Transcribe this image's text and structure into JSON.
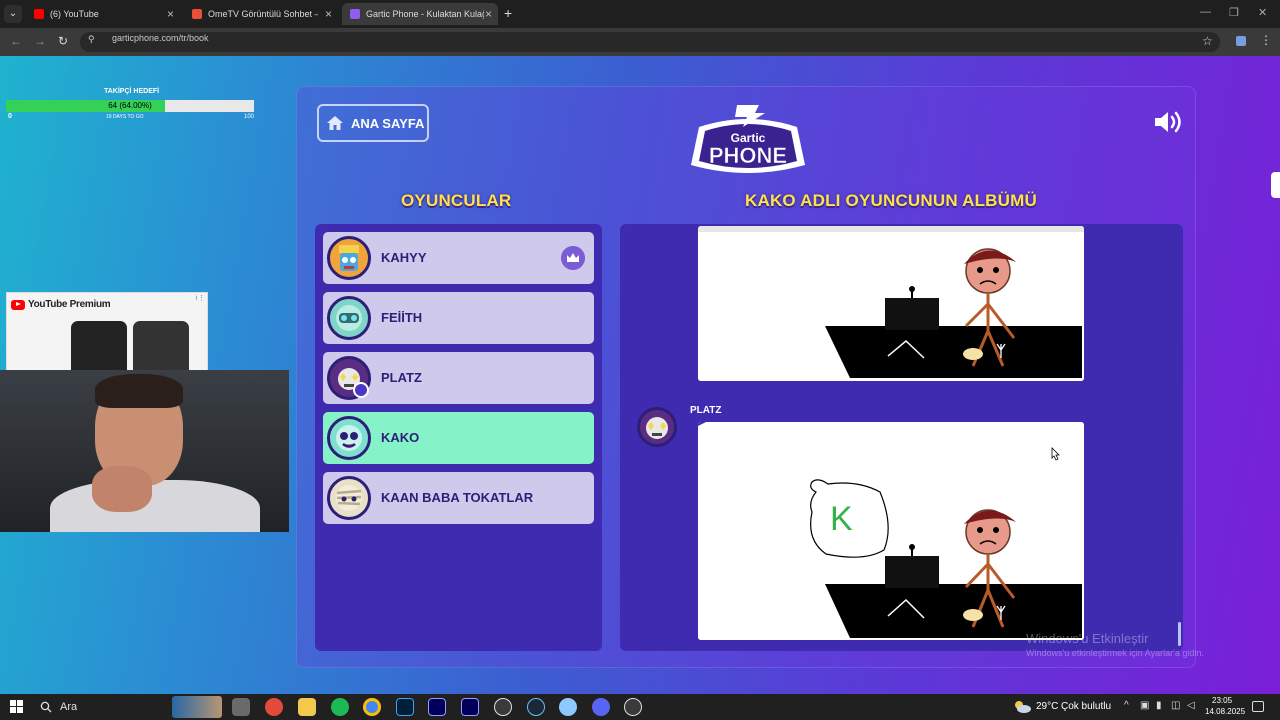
{
  "browser": {
    "tabs": [
      {
        "title": "(6) YouTube",
        "favicon_color": "#ff0000"
      },
      {
        "title": "OmeTV Görüntülü Sohbet — O",
        "favicon_color": "#e8503a"
      },
      {
        "title": "Gartic Phone - Kulaktan Kulağa",
        "favicon_color": "#8f5cf0"
      }
    ],
    "new_tab": "+",
    "url": "garticphone.com/tr/book"
  },
  "stream_overlay": {
    "goal_title": "TAKİPÇİ HEDEFİ",
    "goal_value": "64 (64.00%)",
    "goal_progress": 0.64,
    "goal_min": "0",
    "goal_days": "19 DAYS TO GO",
    "goal_max": "100",
    "ad_brand": "YouTube Premium",
    "ad_info": "i"
  },
  "game": {
    "home_label": "ANA SAYFA",
    "logo_top": "Gartic",
    "logo_bottom": "PHONE",
    "players_title": "OYUNCULAR",
    "album_title": "KAKO ADLI OYUNCUNUN ALBÜMÜ",
    "players": [
      {
        "name": "KAHYY",
        "host": true,
        "active": false,
        "avatar_color": "#f0a43c"
      },
      {
        "name": "FEİİTH",
        "host": false,
        "active": false,
        "avatar_color": "#7fd6c8"
      },
      {
        "name": "PLATZ",
        "host": false,
        "active": false,
        "you": true,
        "avatar_color": "#f4d74a"
      },
      {
        "name": "KAKO",
        "host": false,
        "active": true,
        "avatar_color": "#7fe0d0"
      },
      {
        "name": "KAAN BABA TOKATLAR",
        "host": false,
        "active": false,
        "avatar_color": "#e8e0c8"
      }
    ],
    "album_author": "PLATZ",
    "speech_letter": "K"
  },
  "watermark": {
    "line1": "Windows'u Etkinleştir",
    "line2": "Windows'u etkinleştirmek için Ayarlar'a gidin."
  },
  "taskbar": {
    "search_label": "Ara",
    "weather_temp": "29°C",
    "weather_desc": "Çok bulutlu",
    "time": "23:05",
    "date": "14.08.2025",
    "apps": [
      {
        "name": "task-view",
        "color": "#d0d0d0"
      },
      {
        "name": "browser-red",
        "color": "#e24a3b"
      },
      {
        "name": "file-explorer",
        "color": "#f2c94c"
      },
      {
        "name": "spotify",
        "color": "#1db954"
      },
      {
        "name": "chrome",
        "color": "#4285f4"
      },
      {
        "name": "photoshop",
        "color": "#31a8ff"
      },
      {
        "name": "premiere",
        "color": "#9999ff"
      },
      {
        "name": "after-effects",
        "color": "#9999ff"
      },
      {
        "name": "chatgpt",
        "color": "#e0e0e0"
      },
      {
        "name": "steam",
        "color": "#66c0f4"
      },
      {
        "name": "app-network",
        "color": "#8fc8ff"
      },
      {
        "name": "discord",
        "color": "#5865f2"
      },
      {
        "name": "settings",
        "color": "#e0e0e0"
      }
    ]
  }
}
